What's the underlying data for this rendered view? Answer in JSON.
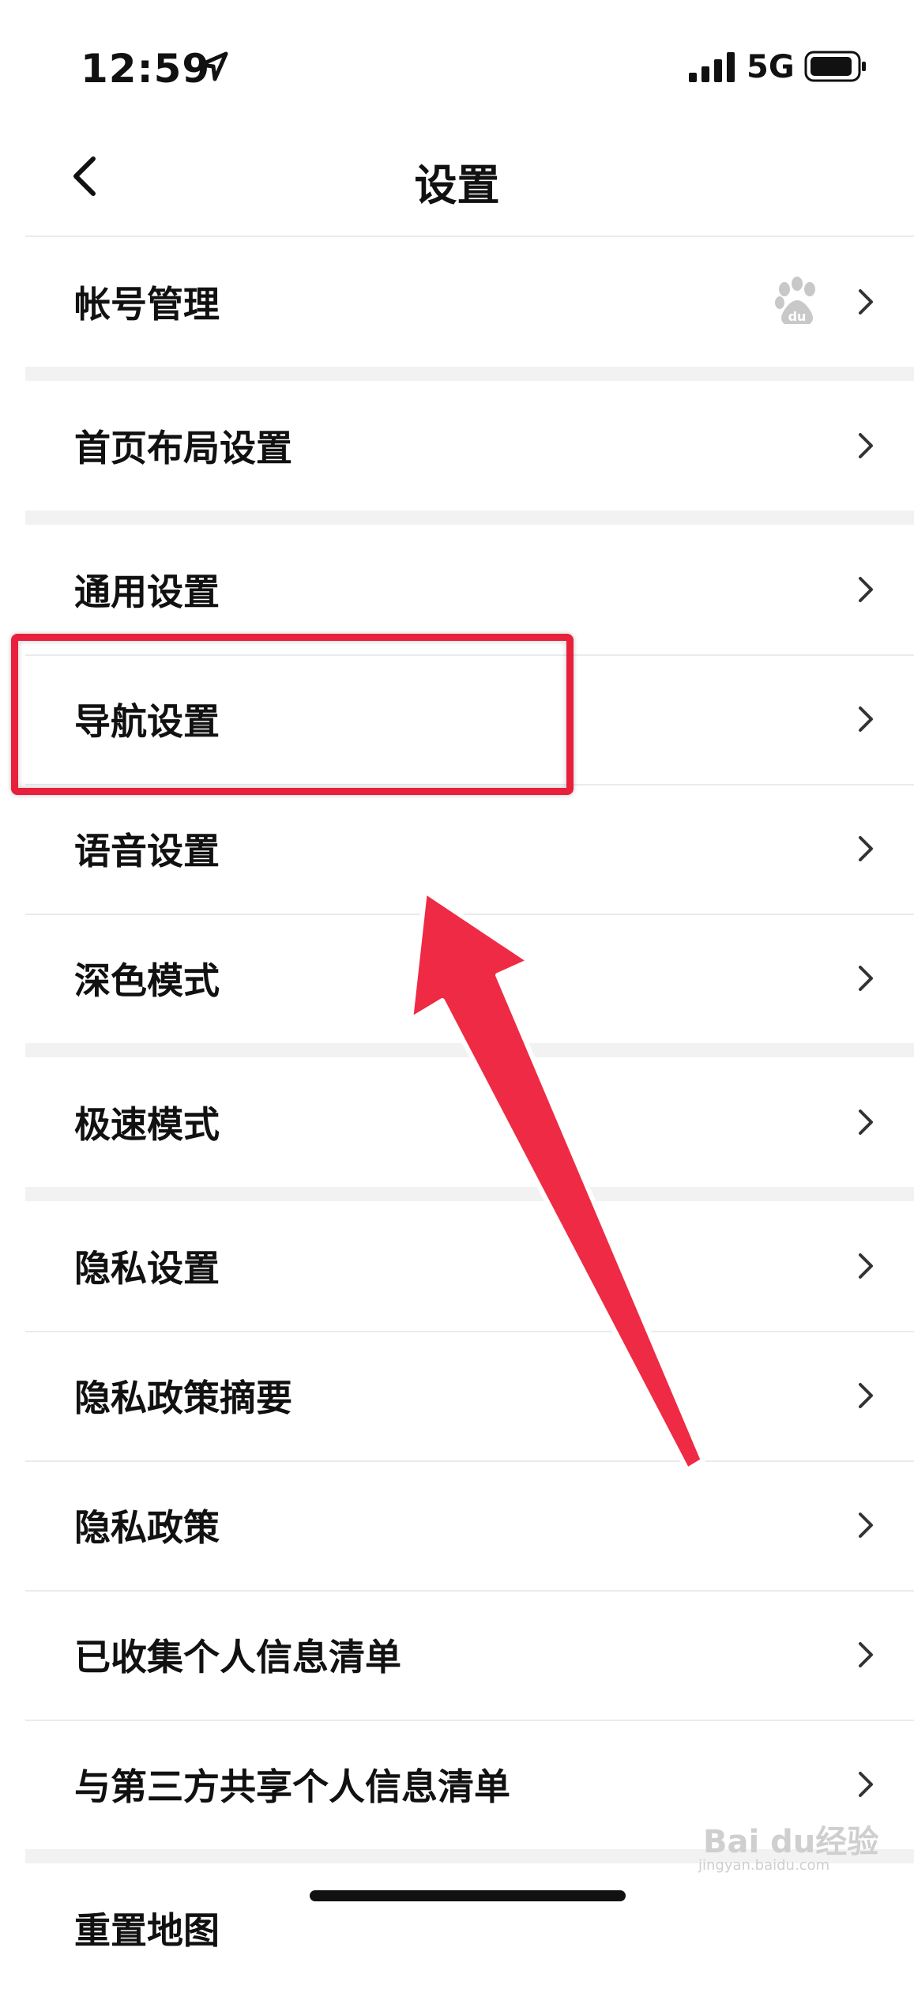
{
  "status_bar": {
    "time": "12:59",
    "network": "5G"
  },
  "nav": {
    "title": "设置"
  },
  "groups": [
    [
      "帐号管理"
    ],
    [
      "首页布局设置"
    ],
    [
      "通用设置",
      "导航设置",
      "语音设置",
      "深色模式"
    ],
    [
      "极速模式"
    ],
    [
      "隐私设置",
      "隐私政策摘要",
      "隐私政策",
      "已收集个人信息清单",
      "与第三方共享个人信息清单"
    ]
  ],
  "partial_next_item": "重置地图",
  "annotation": {
    "highlight_color": "#e8203c"
  },
  "watermark": {
    "text": "Bai du经验",
    "sub": "jingyan.baidu.com"
  }
}
